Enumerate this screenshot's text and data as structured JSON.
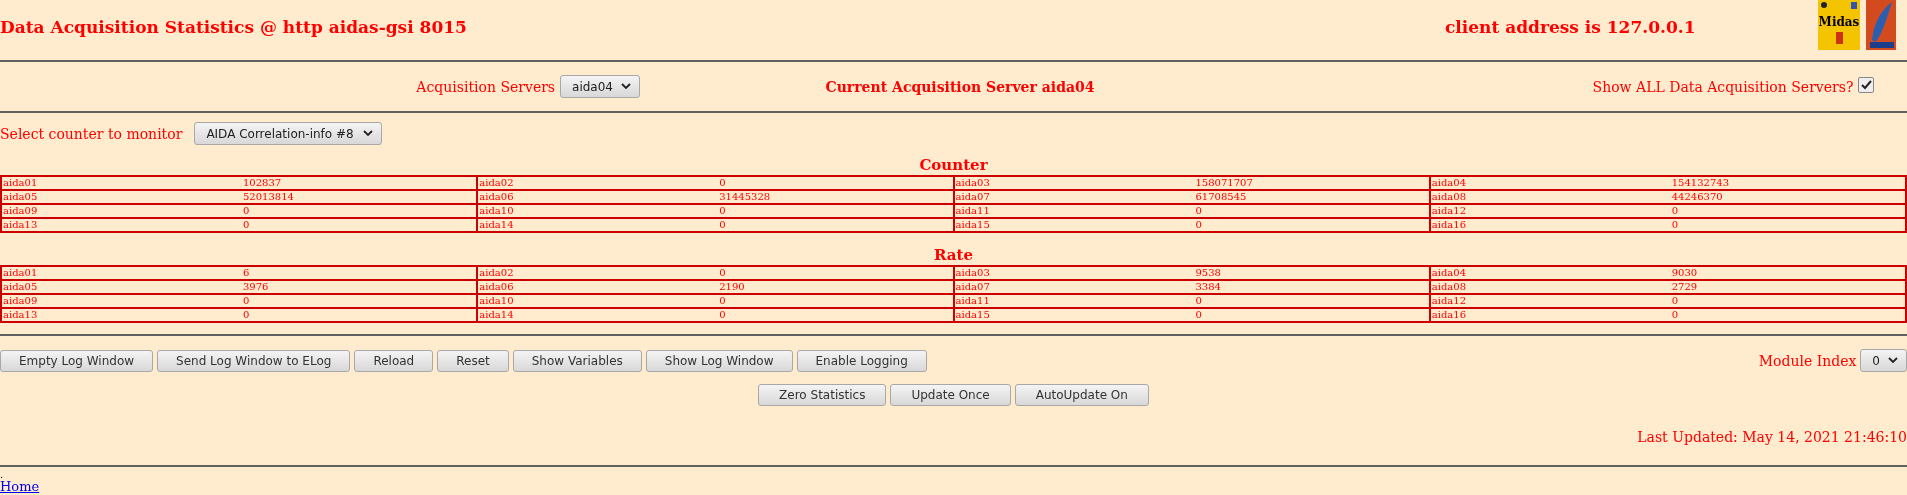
{
  "header": {
    "title": "Data Acquisition Statistics @ http aidas-gsi 8015",
    "client": "client address is 127.0.0.1",
    "logo_text": "Midas"
  },
  "servers": {
    "label": "Acquisition Servers",
    "value": "aida04",
    "current": "Current Acquisition Server aida04",
    "show_all_label": "Show ALL Data Acquisition Servers?",
    "show_all_checked": true
  },
  "counter_select": {
    "label": "Select counter to monitor",
    "value": "AIDA Correlation-info #8"
  },
  "tables": [
    {
      "title": "Counter",
      "cells": [
        {
          "name": "aida01",
          "value": "102837"
        },
        {
          "name": "aida02",
          "value": "0"
        },
        {
          "name": "aida03",
          "value": "158071707"
        },
        {
          "name": "aida04",
          "value": "154132743"
        },
        {
          "name": "aida05",
          "value": "52013814"
        },
        {
          "name": "aida06",
          "value": "31445328"
        },
        {
          "name": "aida07",
          "value": "61708545"
        },
        {
          "name": "aida08",
          "value": "44246370"
        },
        {
          "name": "aida09",
          "value": "0"
        },
        {
          "name": "aida10",
          "value": "0"
        },
        {
          "name": "aida11",
          "value": "0"
        },
        {
          "name": "aida12",
          "value": "0"
        },
        {
          "name": "aida13",
          "value": "0"
        },
        {
          "name": "aida14",
          "value": "0"
        },
        {
          "name": "aida15",
          "value": "0"
        },
        {
          "name": "aida16",
          "value": "0"
        }
      ]
    },
    {
      "title": "Rate",
      "cells": [
        {
          "name": "aida01",
          "value": "6"
        },
        {
          "name": "aida02",
          "value": "0"
        },
        {
          "name": "aida03",
          "value": "9538"
        },
        {
          "name": "aida04",
          "value": "9030"
        },
        {
          "name": "aida05",
          "value": "3976"
        },
        {
          "name": "aida06",
          "value": "2190"
        },
        {
          "name": "aida07",
          "value": "3384"
        },
        {
          "name": "aida08",
          "value": "2729"
        },
        {
          "name": "aida09",
          "value": "0"
        },
        {
          "name": "aida10",
          "value": "0"
        },
        {
          "name": "aida11",
          "value": "0"
        },
        {
          "name": "aida12",
          "value": "0"
        },
        {
          "name": "aida13",
          "value": "0"
        },
        {
          "name": "aida14",
          "value": "0"
        },
        {
          "name": "aida15",
          "value": "0"
        },
        {
          "name": "aida16",
          "value": "0"
        }
      ]
    }
  ],
  "buttons": [
    "Empty Log Window",
    "Send Log Window to ELog",
    "Reload",
    "Reset",
    "Show Variables",
    "Show Log Window",
    "Enable Logging"
  ],
  "module_index": {
    "label": "Module Index",
    "value": "0"
  },
  "update_buttons": [
    "Zero Statistics",
    "Update Once",
    "AutoUpdate On"
  ],
  "last_updated": "Last Updated: May 14, 2021 21:46:10",
  "footer": {
    "dot": ".",
    "link": "Home"
  }
}
